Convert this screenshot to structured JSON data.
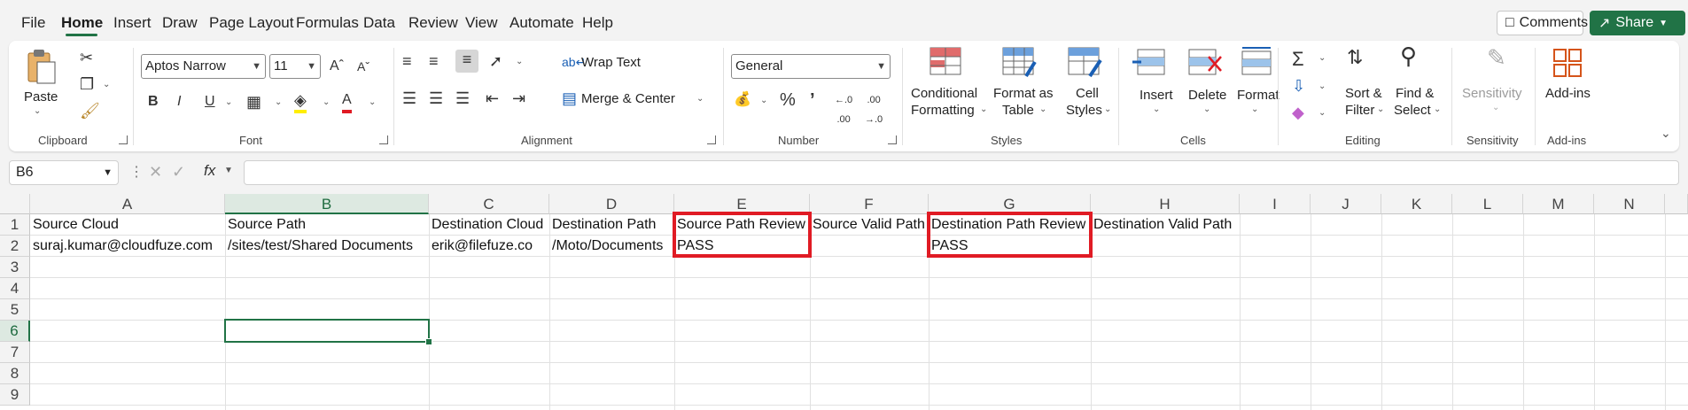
{
  "menu": [
    "File",
    "Home",
    "Insert",
    "Draw",
    "Page Layout",
    "Formulas",
    "Data",
    "Review",
    "View",
    "Automate",
    "Help"
  ],
  "top_buttons": {
    "comments": "Comments",
    "share": "Share"
  },
  "ribbon": {
    "clipboard": {
      "paste": "Paste",
      "label": "Clipboard"
    },
    "font": {
      "family": "Aptos Narrow",
      "size": "11",
      "bold": "B",
      "italic": "I",
      "underline": "U",
      "label": "Font"
    },
    "alignment": {
      "wrap_text": "Wrap Text",
      "merge_center": "Merge & Center",
      "label": "Alignment"
    },
    "number": {
      "format": "General",
      "label": "Number"
    },
    "styles": {
      "conditional_1": "Conditional",
      "conditional_2": "Formatting",
      "format_table_1": "Format as",
      "format_table_2": "Table",
      "cell_styles_1": "Cell",
      "cell_styles_2": "Styles",
      "label": "Styles"
    },
    "cells": {
      "insert": "Insert",
      "delete": "Delete",
      "format": "Format",
      "label": "Cells"
    },
    "editing": {
      "sort_1": "Sort &",
      "sort_2": "Filter",
      "find_1": "Find &",
      "find_2": "Select",
      "label": "Editing"
    },
    "sensitivity": {
      "button": "Sensitivity",
      "label": "Sensitivity"
    },
    "addins": {
      "button": "Add-ins",
      "label": "Add-ins"
    }
  },
  "formula_bar": {
    "name_box": "B6",
    "content": ""
  },
  "grid": {
    "columns": [
      "A",
      "B",
      "C",
      "D",
      "E",
      "F",
      "G",
      "H",
      "I",
      "J",
      "K",
      "L",
      "M",
      "N"
    ],
    "rows": [
      "1",
      "2",
      "3",
      "4",
      "5",
      "6",
      "7",
      "8",
      "9"
    ],
    "selected_cell": "B6",
    "cells": {
      "A1": "Source Cloud",
      "B1": "Source Path",
      "C1": "Destination Cloud",
      "D1": "Destination Path",
      "E1": "Source Path Review",
      "F1": "Source Valid Path",
      "G1": "Destination Path Review",
      "H1": "Destination Valid Path",
      "A2": "suraj.kumar@cloudfuze.com",
      "B2": "/sites/test/Shared Documents",
      "C2": "erik@filefuze.co",
      "D2": "/Moto/Documents",
      "E2": "PASS",
      "G2": "PASS"
    },
    "highlight_color": "#e01b24",
    "accent": "#217346"
  }
}
